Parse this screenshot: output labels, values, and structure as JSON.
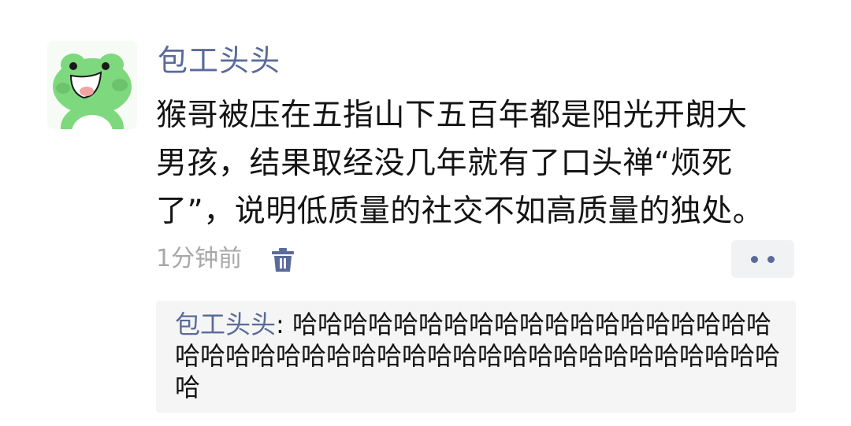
{
  "post": {
    "author": "包工头头",
    "avatar_icon": "green-frog-avatar-icon",
    "content": "猴哥被压在五指山下五百年都是阳光开朗大\n男孩，结果取经没几年就有了口头禅“烦死\n了”，说明低质量的社交不如高质量的独处。",
    "timestamp": "1分钟前",
    "delete_icon": "trash-icon",
    "more_icon": "more-dots-icon"
  },
  "comment": {
    "author": "包工头头",
    "separator": ": ",
    "text": "哈哈哈哈哈哈哈哈哈哈哈哈哈哈哈哈哈哈哈哈哈哈哈哈哈哈哈哈哈哈哈哈哈哈哈哈哈哈哈哈哈哈哈哈"
  },
  "colors": {
    "link": "#5a6b99",
    "text": "#141414",
    "muted": "#a8a8a8",
    "comment_bg": "#f5f5f5",
    "avatar_green": "#7ed87e"
  }
}
